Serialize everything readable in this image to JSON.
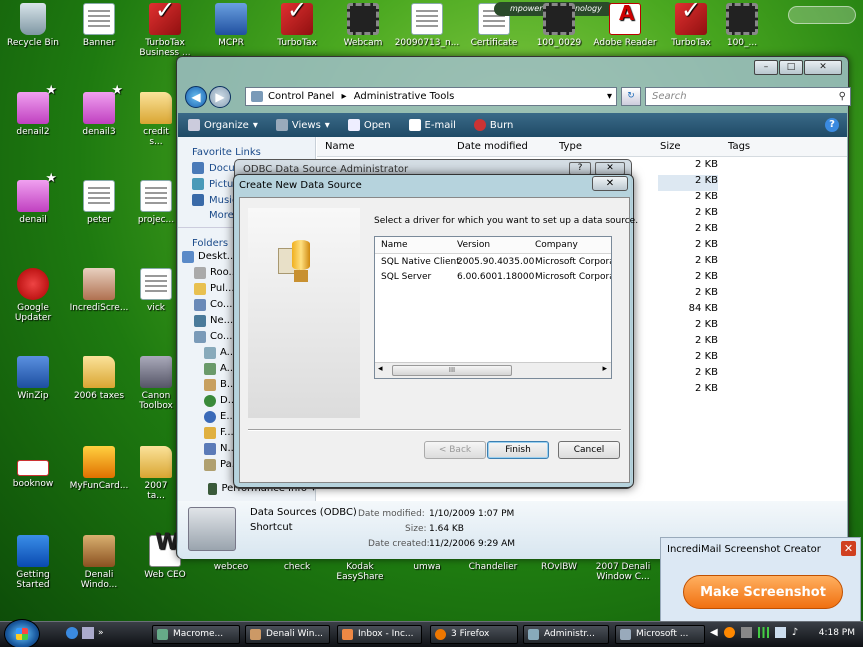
{
  "desktop": {
    "row1": [
      "Recycle Bin",
      "Banner",
      "TurboTax Business ...",
      "MCPR",
      "TurboTax",
      "Webcam",
      "20090713_n...",
      "Certificate",
      "100_0029",
      "Adobe Reader",
      "TurboTax",
      "100_..."
    ],
    "col_left": [
      "denail2",
      "denail",
      "Google Updater",
      "WinZip",
      "booknow",
      "Getting Started"
    ],
    "col_2": [
      "denail3",
      "peter",
      "IncrediScre...",
      "2006 taxes",
      "MyFunCard...",
      "Denali Windo..."
    ],
    "col_3": [
      "credit s...",
      "projec...",
      "vick",
      "Canon Toolbox",
      "2007 ta..."
    ],
    "bottom_row": [
      "Web CEO",
      "webceo",
      "check",
      "Kodak EasyShare",
      "umwa",
      "Chandelier",
      "ROvIBW",
      "2007 Denali Window C..."
    ],
    "empower_text": "mpowering technology"
  },
  "explorer": {
    "title_buttons": [
      "–",
      "□",
      "✕"
    ],
    "back_symbol": "◀",
    "forward_symbol": "▶",
    "address": [
      "Control Panel",
      "Administrative Tools"
    ],
    "search_placeholder": "Search",
    "toolbar": [
      "Organize",
      "Views",
      "Open",
      "E-mail",
      "Burn"
    ],
    "nav": {
      "favorite_links": "Favorite Links",
      "links": [
        "Docu...",
        "Pictu...",
        "Music",
        "More"
      ],
      "folders": "Folders",
      "tree": [
        "Deskt...",
        "Roo...",
        "Pul...",
        "Co...",
        "Ne...",
        "Co...",
        "A...",
        "A...",
        "B...",
        "D...",
        "E...",
        "F...",
        "N...",
        "Pa..."
      ],
      "bottom_item": "Performance Info"
    },
    "columns": [
      "Name",
      "Date modified",
      "Type",
      "Size",
      "Tags"
    ],
    "sizes": [
      "2 KB",
      "2 KB",
      "2 KB",
      "2 KB",
      "2 KB",
      "2 KB",
      "2 KB",
      "2 KB",
      "2 KB",
      "84 KB",
      "2 KB",
      "2 KB",
      "2 KB",
      "2 KB",
      "2 KB"
    ],
    "details": {
      "name": "Data Sources (ODBC)",
      "type": "Shortcut",
      "date_modified_label": "Date modified:",
      "date_modified": "1/10/2009 1:07 PM",
      "size_label": "Size:",
      "size": "1.64 KB",
      "date_created_label": "Date created:",
      "date_created": "11/2/2006 9:29 AM"
    }
  },
  "odbc": {
    "title": "ODBC Data Source Administrator",
    "help": "?",
    "close": "✕"
  },
  "dialog": {
    "title": "Create New Data Source",
    "close": "✕",
    "prompt": "Select a driver for which you want to set up a data source.",
    "columns": [
      "Name",
      "Version",
      "Company"
    ],
    "rows": [
      {
        "name": "SQL Native Client",
        "version": "2005.90.4035.00",
        "company": "Microsoft Corporat"
      },
      {
        "name": "SQL Server",
        "version": "6.00.6001.18000",
        "company": "Microsoft Corporat"
      }
    ],
    "scroll_left": "◂",
    "scroll_right": "▸",
    "scroll_grip": "III",
    "back": "< Back",
    "finish": "Finish",
    "cancel": "Cancel"
  },
  "incredimail": {
    "title": "IncrediMail Screenshot Creator",
    "close": "✕",
    "button": "Make Screenshot"
  },
  "taskbar": {
    "tasks": [
      "Macrome...",
      "Denali Win...",
      "Inbox - Inc...",
      "3 Firefox",
      "Administr...",
      "Microsoft ..."
    ],
    "clock": "4:18 PM"
  }
}
